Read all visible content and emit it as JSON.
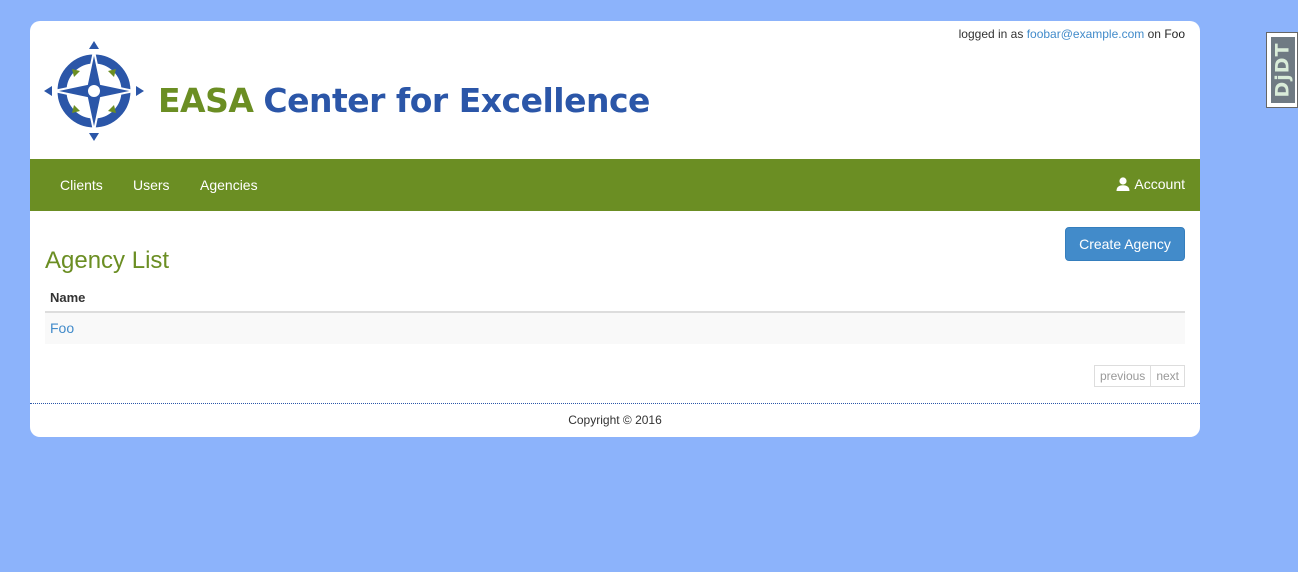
{
  "header": {
    "login_prefix": "logged in as",
    "user_email": "foobar@example.com",
    "on_text": "on",
    "org_name": "Foo",
    "brand_primary": "EASA",
    "brand_secondary": "Center for Excellence"
  },
  "nav": {
    "items": [
      {
        "label": "Clients"
      },
      {
        "label": "Users"
      },
      {
        "label": "Agencies"
      }
    ],
    "account_label": "Account",
    "account_icon": "user-icon"
  },
  "main": {
    "title": "Agency List",
    "create_button": "Create Agency",
    "table": {
      "columns": [
        "Name"
      ],
      "rows": [
        {
          "name": "Foo"
        }
      ]
    },
    "pager": {
      "previous": "previous",
      "next": "next"
    }
  },
  "footer": {
    "copyright": "Copyright © 2016"
  },
  "debug_toolbar": {
    "label": "DjDT"
  },
  "colors": {
    "background": "#8cb3fb",
    "brand_green": "#6b8e23",
    "brand_blue": "#2b56a8",
    "link_blue": "#428bca"
  }
}
